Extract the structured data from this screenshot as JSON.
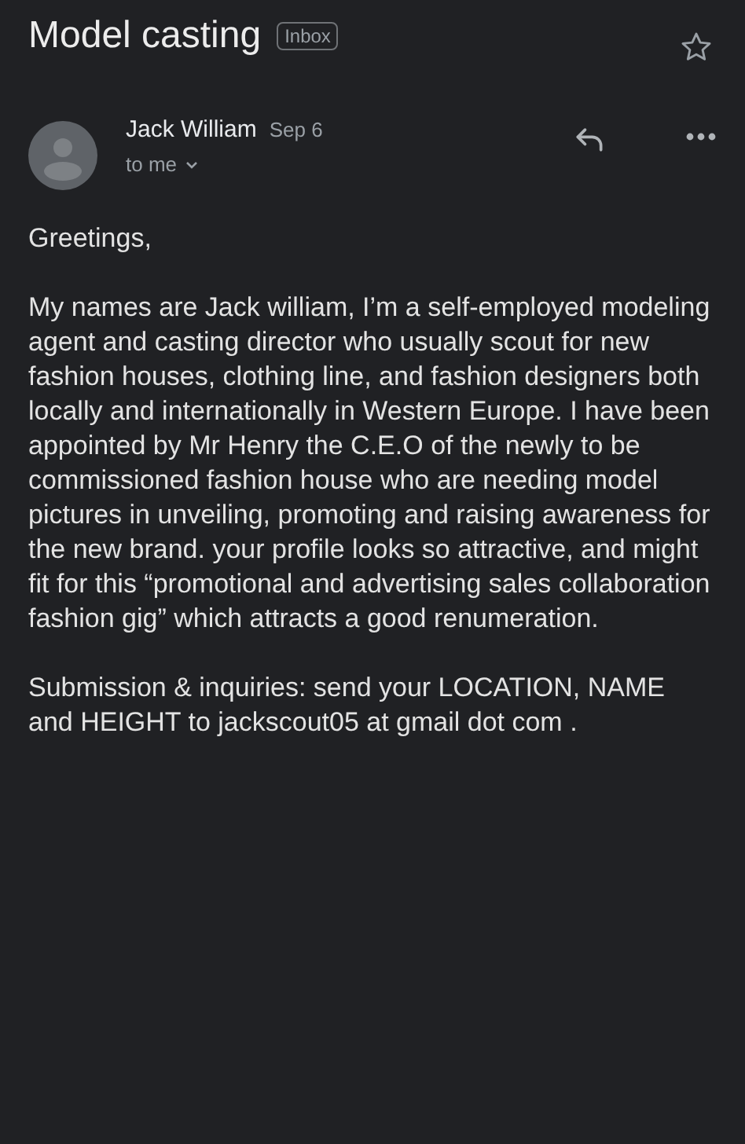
{
  "subject": "Model casting",
  "label": "Inbox",
  "starred": false,
  "sender": {
    "name": "Jack William",
    "date": "Sep 6",
    "recipient": "to me"
  },
  "body": [
    "Greetings,",
    "My names are Jack william, I’m a self-employed modeling agent and casting director who usually scout for new fashion houses, clothing line, and fashion designers both locally and internationally in Western Europe. I have been appointed by Mr Henry the C.E.O of the newly to be commissioned fashion house who are needing model pictures in unveiling, promoting and raising awareness for the new brand. your profile looks so attractive, and might fit for this “promotional and advertising sales collaboration fashion gig” which attracts a good renumeration.",
    "Submission & inquiries: send your LOCATION, NAME and HEIGHT to jackscout05 at gmail dot com ."
  ]
}
